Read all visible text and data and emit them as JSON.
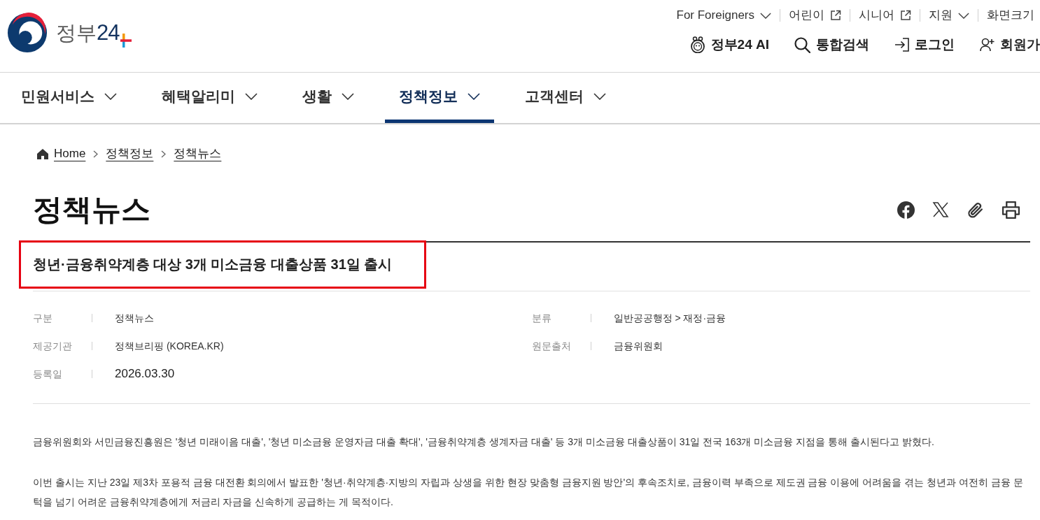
{
  "logo": {
    "name_part": "정부",
    "number_part": "24"
  },
  "utility_links": [
    {
      "label": "For Foreigners",
      "kind": "dropdown"
    },
    {
      "label": "어린이",
      "kind": "external"
    },
    {
      "label": "시니어",
      "kind": "external"
    },
    {
      "label": "지원",
      "kind": "dropdown"
    },
    {
      "label": "화면크기",
      "kind": "plain"
    }
  ],
  "header_actions": [
    {
      "label": "정부24 AI",
      "kind": "ai"
    },
    {
      "label": "통합검색",
      "kind": "search"
    },
    {
      "label": "로그인",
      "kind": "login"
    },
    {
      "label": "회원가",
      "kind": "signup"
    }
  ],
  "nav": [
    {
      "label": "민원서비스",
      "selected": false
    },
    {
      "label": "혜택알리미",
      "selected": false
    },
    {
      "label": "생활",
      "selected": false
    },
    {
      "label": "정책정보",
      "selected": true
    },
    {
      "label": "고객센터",
      "selected": false
    }
  ],
  "breadcrumb": [
    {
      "label": "Home",
      "kind": "home"
    },
    {
      "label": "정책정보",
      "kind": "link"
    },
    {
      "label": "정책뉴스",
      "kind": "link"
    }
  ],
  "page_title": "정책뉴스",
  "article": {
    "title": "청년·금융취약계층 대상 3개 미소금융 대출상품 31일 출시",
    "highlighted": true,
    "meta": [
      {
        "label": "구분",
        "value": "정책뉴스",
        "kind": "text"
      },
      {
        "label": "분류",
        "value": "일반공공행정 > 재정·금융",
        "kind": "text"
      },
      {
        "label": "제공기관",
        "value": "정책브리핑 (KOREA.KR)",
        "kind": "text"
      },
      {
        "label": "원문출처",
        "value": "금융위원회",
        "kind": "text"
      },
      {
        "label": "등록일",
        "value": "2026.03.30",
        "kind": "date"
      }
    ],
    "paragraphs": [
      "금융위원회와 서민금융진흥원은 '청년 미래이음 대출', '청년 미소금융 운영자금 대출 확대', '금융취약계층 생계자금 대출' 등 3개 미소금융 대출상품이 31일 전국 163개 미소금융 지점을 통해 출시된다고 밝혔다.",
      "이번 출시는 지난 23일 제3차 포용적 금융 대전환 회의에서 발표한 '청년·취약계층·지방의 자립과 상생을 위한 현장 맞춤형 금융지원 방안'의 후속조치로, 금융이력 부족으로 제도권 금융 이용에 어려움을 겪는 청년과 여전히 금융 문턱을 넘기 어려운 금융취약계층에게 저금리 자금을 신속하게 공급하는 게 목적이다."
    ]
  }
}
